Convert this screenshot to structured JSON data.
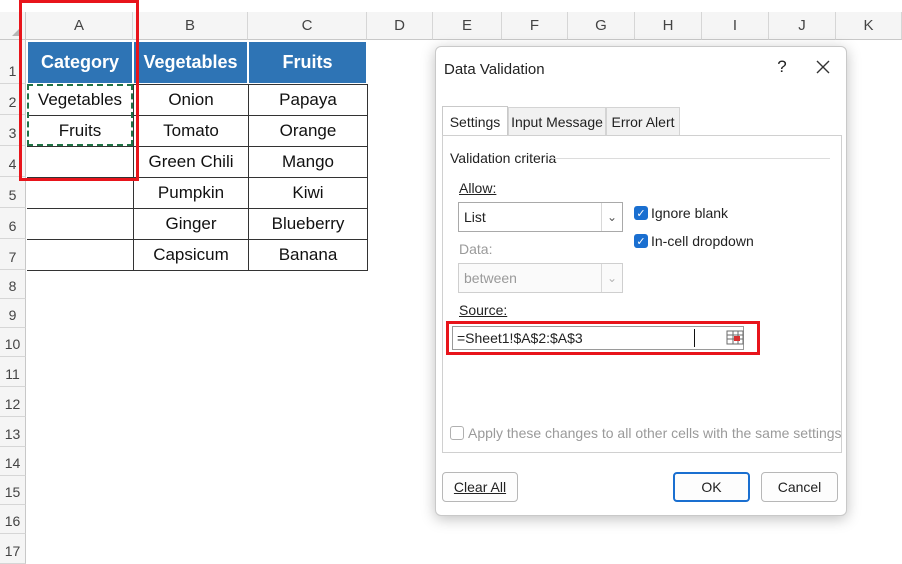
{
  "sheet": {
    "columns": [
      "A",
      "B",
      "C",
      "D",
      "E",
      "F",
      "G",
      "H",
      "I",
      "J",
      "K"
    ],
    "rows": [
      "1",
      "2",
      "3",
      "4",
      "5",
      "6",
      "7",
      "8",
      "9",
      "10",
      "11",
      "12",
      "13",
      "14",
      "15",
      "16",
      "17"
    ],
    "table": {
      "headers": [
        "Category",
        "Vegetables",
        "Fruits"
      ],
      "colA": [
        "Vegetables",
        "Fruits",
        "",
        "",
        "",
        ""
      ],
      "colB": [
        "Onion",
        "Tomato",
        "Green Chili",
        "Pumpkin",
        "Ginger",
        "Capsicum"
      ],
      "colC": [
        "Papaya",
        "Orange",
        "Mango",
        "Kiwi",
        "Blueberry",
        "Banana"
      ]
    }
  },
  "dialog": {
    "title": "Data Validation",
    "help": "?",
    "close": "X",
    "tabs": [
      "Settings",
      "Input Message",
      "Error Alert"
    ],
    "section_title": "Validation criteria",
    "allow_label": "Allow:",
    "allow_value": "List",
    "ignore_blank": "Ignore blank",
    "incell_dropdown": "In-cell dropdown",
    "data_label": "Data:",
    "data_value": "between",
    "source_label": "Source:",
    "source_value": "=Sheet1!$A$2:$A$3",
    "apply_text": "Apply these changes to all other cells with the same settings",
    "clear_all": "Clear All",
    "ok": "OK",
    "cancel": "Cancel"
  },
  "colors": {
    "header_fill": "#2e74b5",
    "highlight": "#e8141b",
    "accent": "#1a6fd0",
    "copy_border": "#217346"
  }
}
